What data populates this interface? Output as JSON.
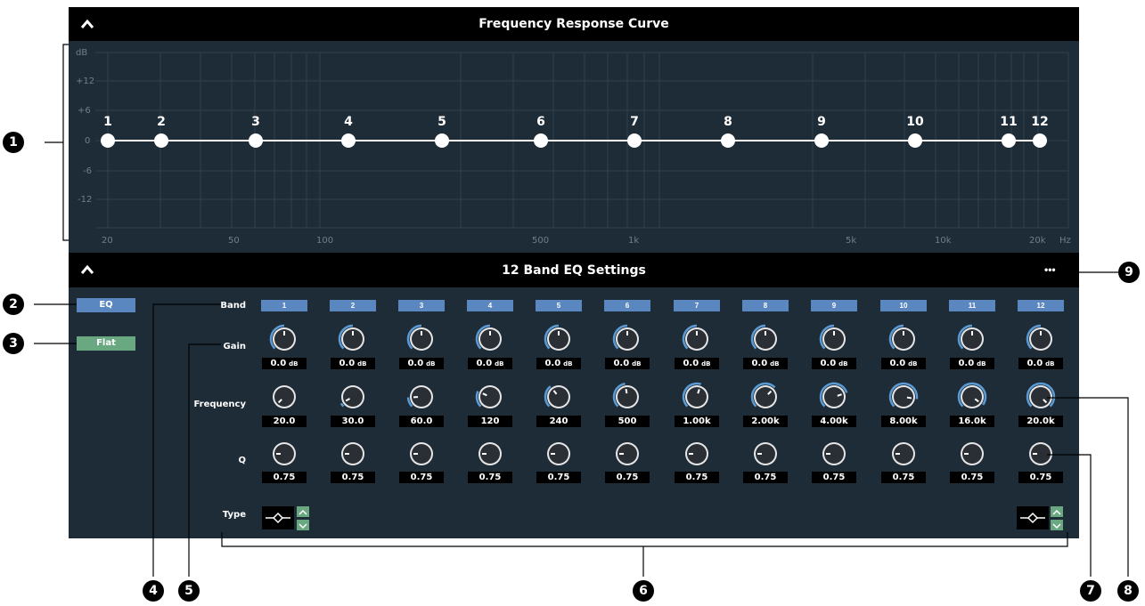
{
  "graph_panel": {
    "title": "Frequency Response Curve"
  },
  "graph": {
    "y_unit": "dB",
    "y_ticks": [
      "+12",
      "+6",
      "0",
      "-6",
      "-12"
    ],
    "x_unit": "Hz",
    "x_ticks": [
      "20",
      "50",
      "100",
      "500",
      "1k",
      "5k",
      "10k",
      "20k"
    ]
  },
  "settings_panel": {
    "title": "12 Band EQ Settings",
    "more_label": "•••"
  },
  "side_buttons": {
    "eq": "EQ",
    "flat": "Flat"
  },
  "row_labels": {
    "band": "Band",
    "gain": "Gain",
    "frequency": "Frequency",
    "q": "Q",
    "type": "Type"
  },
  "units": {
    "gain": "dB"
  },
  "bands": [
    {
      "label": "1",
      "gain": "0.0",
      "frequency": "20.0",
      "q": "0.75"
    },
    {
      "label": "2",
      "gain": "0.0",
      "frequency": "30.0",
      "q": "0.75"
    },
    {
      "label": "3",
      "gain": "0.0",
      "frequency": "60.0",
      "q": "0.75"
    },
    {
      "label": "4",
      "gain": "0.0",
      "frequency": "120",
      "q": "0.75"
    },
    {
      "label": "5",
      "gain": "0.0",
      "frequency": "240",
      "q": "0.75"
    },
    {
      "label": "6",
      "gain": "0.0",
      "frequency": "500",
      "q": "0.75"
    },
    {
      "label": "7",
      "gain": "0.0",
      "frequency": "1.00k",
      "q": "0.75"
    },
    {
      "label": "8",
      "gain": "0.0",
      "frequency": "2.00k",
      "q": "0.75"
    },
    {
      "label": "9",
      "gain": "0.0",
      "frequency": "4.00k",
      "q": "0.75"
    },
    {
      "label": "10",
      "gain": "0.0",
      "frequency": "8.00k",
      "q": "0.75"
    },
    {
      "label": "11",
      "gain": "0.0",
      "frequency": "16.0k",
      "q": "0.75"
    },
    {
      "label": "12",
      "gain": "0.0",
      "frequency": "20.0k",
      "q": "0.75"
    }
  ],
  "callouts": [
    "1",
    "2",
    "3",
    "4",
    "5",
    "6",
    "7",
    "8",
    "9"
  ],
  "colors": {
    "panel_bg": "#1e2c38",
    "band_button": "#5b87c0",
    "green_button": "#6aa882",
    "knob_arc": "#5a9bd5"
  }
}
